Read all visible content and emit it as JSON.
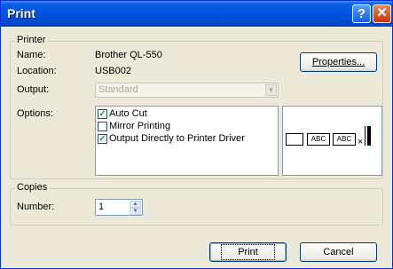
{
  "window": {
    "title": "Print"
  },
  "titlebar": {
    "help_glyph": "?",
    "close_glyph": "✕"
  },
  "printer": {
    "group_label": "Printer",
    "name_label": "Name:",
    "name_value": "Brother QL-550",
    "location_label": "Location:",
    "location_value": "USB002",
    "output_label": "Output:",
    "output_value": "Standard",
    "options_label": "Options:",
    "options": [
      {
        "label": "Auto Cut",
        "checked": true
      },
      {
        "label": "Mirror Printing",
        "checked": false
      },
      {
        "label": "Output Directly to Printer Driver",
        "checked": true
      }
    ],
    "properties_button": "Properties..."
  },
  "preview": {
    "label_a": "ABC",
    "label_b": "ABC",
    "cut_mark": "×"
  },
  "copies": {
    "group_label": "Copies",
    "number_label": "Number:",
    "number_value": "1"
  },
  "buttons": {
    "print": "Print",
    "cancel": "Cancel"
  },
  "icons": {
    "help": "help-icon",
    "close": "close-icon",
    "spin_up": "chevron-up-icon",
    "spin_down": "chevron-down-icon",
    "combo": "chevron-down-icon"
  },
  "colors": {
    "titlebar": "#0054e3",
    "dialog_bg": "#ece9d8",
    "button_border": "#003c74"
  }
}
